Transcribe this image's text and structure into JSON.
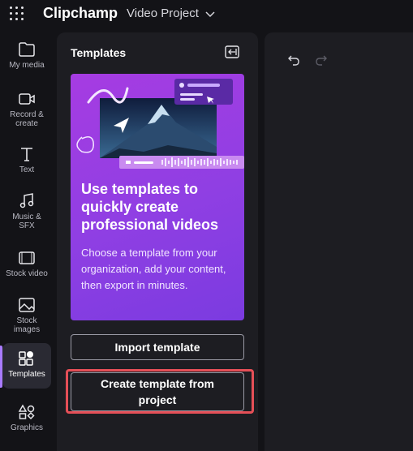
{
  "app": {
    "title": "Clipchamp",
    "project_name": "Video Project"
  },
  "nav": {
    "items": [
      {
        "id": "my-media",
        "label": "My media",
        "icon": "folder-icon"
      },
      {
        "id": "record-create",
        "label": "Record &\ncreate",
        "icon": "camera-icon"
      },
      {
        "id": "text",
        "label": "Text",
        "icon": "text-icon"
      },
      {
        "id": "music-sfx",
        "label": "Music &\nSFX",
        "icon": "music-note-icon"
      },
      {
        "id": "stock-video",
        "label": "Stock video",
        "icon": "film-icon"
      },
      {
        "id": "stock-images",
        "label": "Stock\nimages",
        "icon": "image-icon"
      },
      {
        "id": "templates",
        "label": "Templates",
        "icon": "templates-icon",
        "active": true
      },
      {
        "id": "graphics",
        "label": "Graphics",
        "icon": "shapes-icon"
      }
    ]
  },
  "panel": {
    "title": "Templates",
    "promo": {
      "heading": "Use templates to quickly create professional videos",
      "body": "Choose a template from your organization, add your content, then export in minutes."
    },
    "import_label": "Import template",
    "create_label": "Create template from project"
  },
  "colors": {
    "accent": "#a97bff",
    "promo_gradient_start": "#a63ce2",
    "promo_gradient_end": "#7b3be0",
    "highlight": "#e54f57"
  }
}
